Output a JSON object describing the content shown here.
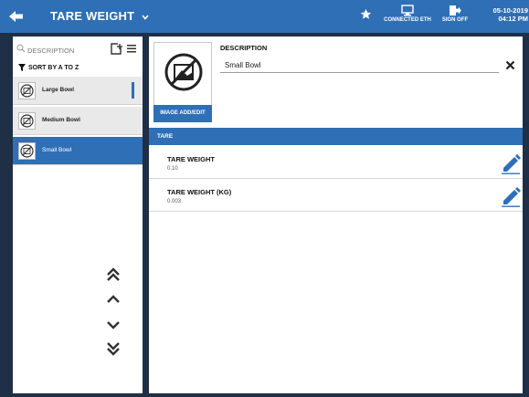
{
  "header": {
    "title": "TARE WEIGHT",
    "connection_label": "CONNECTED ETH",
    "sign_off_label": "SIGN OFF",
    "date": "05-10-2019",
    "time": "04:12 PM"
  },
  "sidebar": {
    "search_placeholder": "DESCRIPTION",
    "sort_label": "SORT BY A TO Z",
    "items": [
      {
        "label": "Large Bowl"
      },
      {
        "label": "Medium Bowl"
      },
      {
        "label": "Small Bowl"
      }
    ],
    "selected_index": 2
  },
  "detail": {
    "image_button_label": "IMAGE ADD/EDIT",
    "description_label": "DESCRIPTION",
    "description_value": "Small Bowl",
    "section_title": "TARE",
    "fields": [
      {
        "label": "TARE WEIGHT",
        "value": "0.10"
      },
      {
        "label": "TARE WEIGHT (KG)",
        "value": "0.003"
      }
    ]
  },
  "colors": {
    "accent": "#2f6fb6",
    "frame": "#1f2f45",
    "list_bg": "#e9e9e9"
  }
}
